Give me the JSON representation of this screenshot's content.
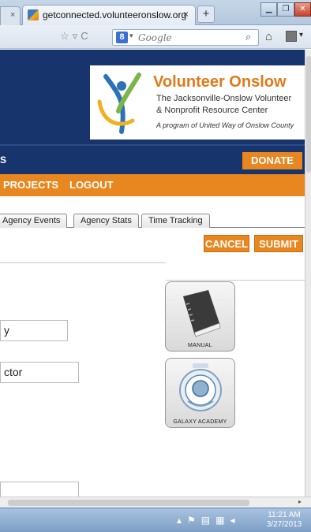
{
  "browser": {
    "tab_title": "getconnected.volunteeronslow.org",
    "tab_close": "×",
    "new_tab": "+",
    "search_placeholder": "Google",
    "search_engine": "8"
  },
  "header": {
    "logo_title": "Volunteer Onslow",
    "logo_sub1": "The Jacksonville-Onslow Volunteer",
    "logo_sub2": "& Nonprofit Resource Center",
    "logo_tag": "A program of United Way of Onslow County",
    "bluebar_fragment": "S",
    "donate_label": "DONATE"
  },
  "nav": {
    "projects": "PROJECTS",
    "logout": "LOGOUT"
  },
  "page_tabs": [
    "Agency Events",
    "Agency Stats",
    "Time Tracking"
  ],
  "actions": {
    "cancel": "CANCEL",
    "submit": "SUBMIT"
  },
  "fields": {
    "field1_value": "y",
    "field2_value": "ctor",
    "field3_value": ""
  },
  "side_buttons": {
    "manual_label": "MANUAL",
    "academy_label": "GALAXY ACADEMY"
  },
  "taskbar": {
    "time": "11:21 AM",
    "date": "3/27/2013"
  },
  "colors": {
    "header_navy": "#17346c",
    "accent_orange": "#e8861f"
  }
}
